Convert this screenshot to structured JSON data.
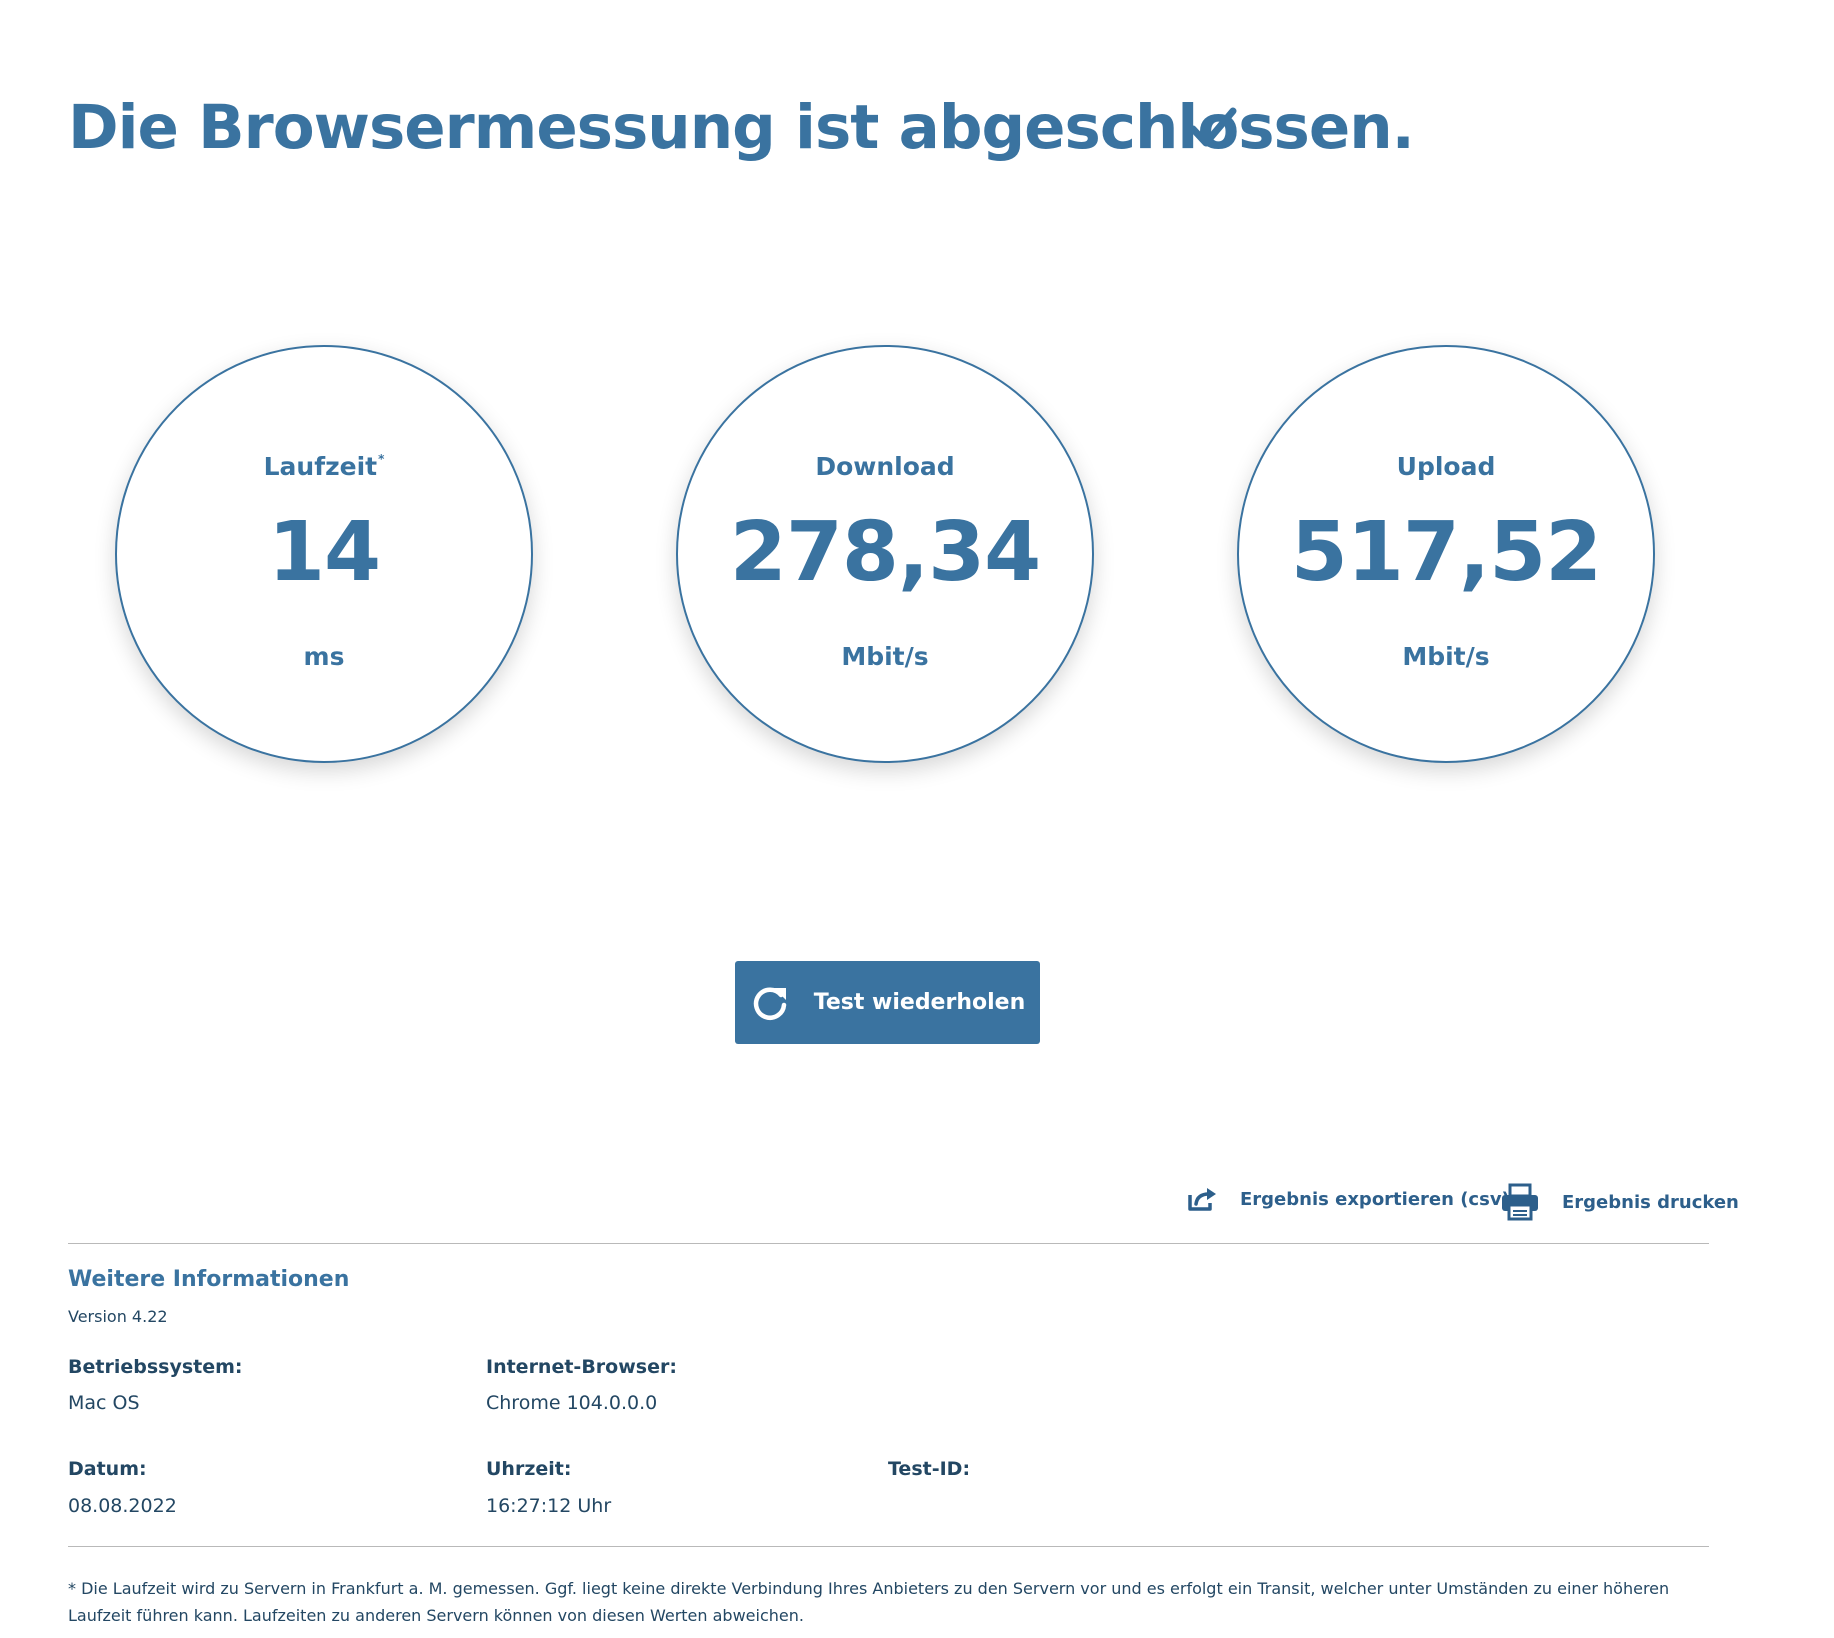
{
  "heading": {
    "title": "Die Browsermessung ist abgeschlossen."
  },
  "results": {
    "latency": {
      "label": "Laufzeit",
      "marker": "*",
      "value": "14",
      "unit": "ms"
    },
    "download": {
      "label": "Download",
      "value": "278,34",
      "unit": "Mbit/s"
    },
    "upload": {
      "label": "Upload",
      "value": "517,52",
      "unit": "Mbit/s"
    }
  },
  "actions": {
    "retest_label": "Test wiederholen",
    "export_label": "Ergebnis exportieren (csv)",
    "print_label": "Ergebnis drucken"
  },
  "info": {
    "title": "Weitere Informationen",
    "version": "Version 4.22",
    "os_label": "Betriebssystem:",
    "os_value": "Mac OS",
    "browser_label": "Internet-Browser:",
    "browser_value": "Chrome 104.0.0.0",
    "date_label": "Datum:",
    "date_value": "08.08.2022",
    "time_label": "Uhrzeit:",
    "time_value": "16:27:12 Uhr",
    "testid_label": "Test-ID:",
    "testid_value": ""
  },
  "footnote": "* Die Laufzeit wird zu Servern in Frankfurt a. M. gemessen. Ggf. liegt keine direkte Verbindung Ihres Anbieters zu den Servern vor und es erfolgt ein Transit, welcher unter Umständen zu einer höheren Laufzeit führen kann. Laufzeiten zu anderen Servern können von diesen Werten abweichen.",
  "colors": {
    "accent": "#3a73a0",
    "text_dark": "#234763",
    "divider": "#b9b9b9"
  },
  "icons": {
    "headline": "checkmark-icon",
    "retest": "refresh-icon",
    "export": "share-export-icon",
    "print": "printer-icon"
  }
}
